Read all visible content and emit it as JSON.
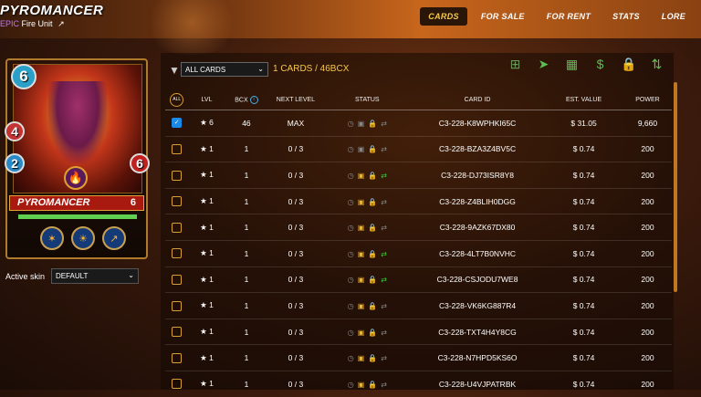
{
  "header": {
    "title": "PYROMANCER",
    "rarity": "EPIC",
    "subtitle": "Fire Unit",
    "tabs": [
      "CARDS",
      "FOR SALE",
      "FOR RENT",
      "STATS",
      "LORE"
    ],
    "active_tab": "CARDS"
  },
  "card": {
    "mana": "6",
    "attack": "4",
    "speed": "2",
    "health": "6",
    "name": "PYROMANCER",
    "level": "6",
    "xp_fill": 1.0,
    "ability_icons": [
      "blast-icon",
      "fire-icon",
      "wand-icon"
    ]
  },
  "skin": {
    "label": "Active skin",
    "value": "DEFAULT"
  },
  "filter": {
    "value": "ALL CARDS",
    "count_text": "1 CARDS / 46BCX"
  },
  "toolbar_icons": [
    "combine-icon",
    "send-icon",
    "market-icon",
    "transfer-icon",
    "lock-icon",
    "burn-icon"
  ],
  "table": {
    "headers": {
      "all": "ALL",
      "lvl": "LVL",
      "bcx": "BCX",
      "next_level": "NEXT LEVEL",
      "status": "STATUS",
      "card_id": "CARD ID",
      "value": "EST. VALUE",
      "power": "POWER"
    },
    "rows": [
      {
        "checked": true,
        "lvl": "★ 6",
        "bcx": "46",
        "next": "MAX",
        "card_id": "C3-228-K8WPHKI65C",
        "value": "$ 31.05",
        "power": "9,660",
        "status": [
          "grey",
          "grey",
          "grey",
          "grey"
        ]
      },
      {
        "checked": false,
        "lvl": "★ 1",
        "bcx": "1",
        "next": "0 / 3",
        "card_id": "C3-228-BZA3Z4BV5C",
        "value": "$ 0.74",
        "power": "200",
        "status": [
          "grey",
          "grey",
          "green",
          "grey"
        ]
      },
      {
        "checked": false,
        "lvl": "★ 1",
        "bcx": "1",
        "next": "0 / 3",
        "card_id": "C3-228-DJ73ISR8Y8",
        "value": "$ 0.74",
        "power": "200",
        "status": [
          "grey",
          "yellow",
          "green",
          "green"
        ]
      },
      {
        "checked": false,
        "lvl": "★ 1",
        "bcx": "1",
        "next": "0 / 3",
        "card_id": "C3-228-Z4BLIH0DGG",
        "value": "$ 0.74",
        "power": "200",
        "status": [
          "grey",
          "yellow",
          "green",
          "grey"
        ]
      },
      {
        "checked": false,
        "lvl": "★ 1",
        "bcx": "1",
        "next": "0 / 3",
        "card_id": "C3-228-9AZK67DX80",
        "value": "$ 0.74",
        "power": "200",
        "status": [
          "grey",
          "yellow",
          "green",
          "grey"
        ]
      },
      {
        "checked": false,
        "lvl": "★ 1",
        "bcx": "1",
        "next": "0 / 3",
        "card_id": "C3-228-4LT7B0NVHC",
        "value": "$ 0.74",
        "power": "200",
        "status": [
          "grey",
          "yellow",
          "green",
          "green"
        ]
      },
      {
        "checked": false,
        "lvl": "★ 1",
        "bcx": "1",
        "next": "0 / 3",
        "card_id": "C3-228-CSJODU7WE8",
        "value": "$ 0.74",
        "power": "200",
        "status": [
          "grey",
          "yellow",
          "green",
          "green"
        ]
      },
      {
        "checked": false,
        "lvl": "★ 1",
        "bcx": "1",
        "next": "0 / 3",
        "card_id": "C3-228-VK6KG887R4",
        "value": "$ 0.74",
        "power": "200",
        "status": [
          "grey",
          "yellow",
          "green",
          "grey"
        ]
      },
      {
        "checked": false,
        "lvl": "★ 1",
        "bcx": "1",
        "next": "0 / 3",
        "card_id": "C3-228-TXT4H4Y8CG",
        "value": "$ 0.74",
        "power": "200",
        "status": [
          "grey",
          "yellow",
          "green",
          "grey"
        ]
      },
      {
        "checked": false,
        "lvl": "★ 1",
        "bcx": "1",
        "next": "0 / 3",
        "card_id": "C3-228-N7HPD5KS6O",
        "value": "$ 0.74",
        "power": "200",
        "status": [
          "grey",
          "yellow",
          "green",
          "grey"
        ]
      },
      {
        "checked": false,
        "lvl": "★ 1",
        "bcx": "1",
        "next": "0 / 3",
        "card_id": "C3-228-U4VJPATRBK",
        "value": "$ 0.74",
        "power": "200",
        "status": [
          "grey",
          "yellow",
          "green",
          "grey"
        ]
      }
    ]
  },
  "colors": {
    "accent": "#f6c84a",
    "checkbox_border": "#d8a030",
    "status_green": "#3ecc3e",
    "status_yellow": "#e8b440"
  }
}
